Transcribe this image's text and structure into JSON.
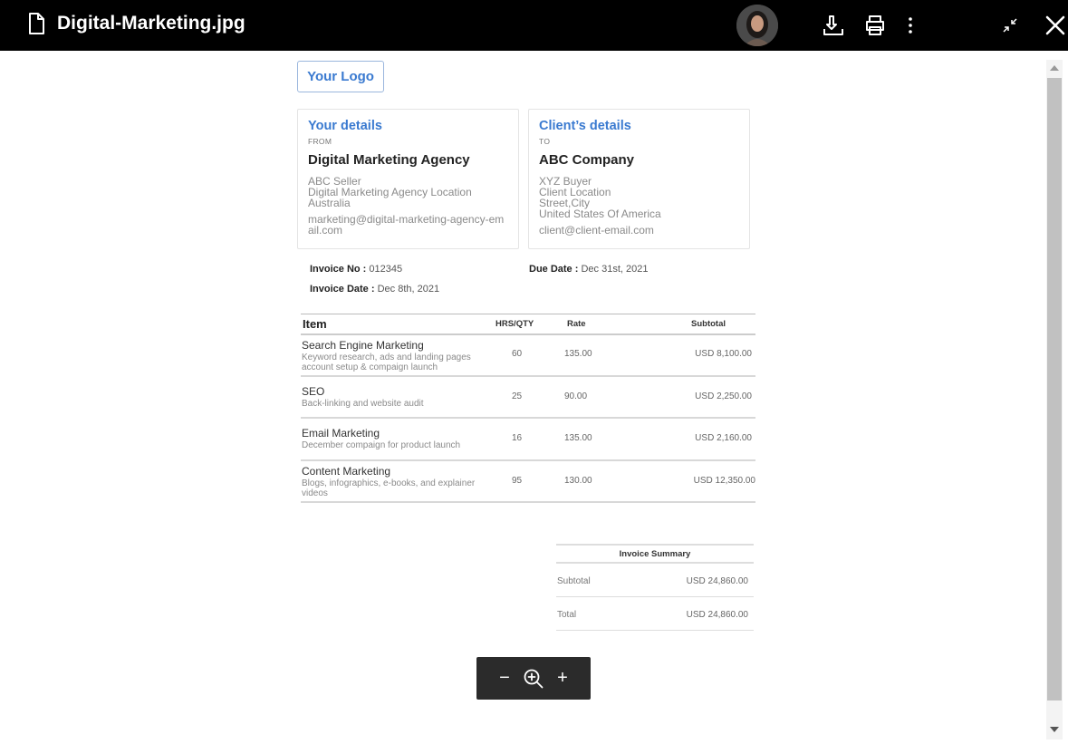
{
  "viewer": {
    "file_name": "Digital-Marketing.jpg",
    "icons": [
      "file-icon",
      "avatar",
      "download-icon",
      "print-icon",
      "more-icon",
      "collapse-icon",
      "close-icon"
    ]
  },
  "invoice": {
    "logo": "Your Logo",
    "from": {
      "title": "Your details",
      "label": "FROM",
      "name": "Digital Marketing Agency",
      "address_lines": [
        "ABC Seller",
        "Digital Marketing Agency Location",
        "Australia"
      ],
      "email": "marketing@digital-marketing-agency-email.com"
    },
    "to": {
      "title": "Client’s details",
      "label": "TO",
      "name": "ABC Company",
      "address_lines": [
        "XYZ Buyer",
        "Client Location",
        "Street,City",
        "United States Of America"
      ],
      "email": "client@client-email.com"
    },
    "meta": {
      "invoice_no_label": "Invoice No :",
      "invoice_no": "012345",
      "invoice_date_label": "Invoice Date :",
      "invoice_date": "Dec 8th, 2021",
      "due_date_label": "Due Date :",
      "due_date": "Dec 31st, 2021"
    },
    "columns": {
      "item": "Item",
      "qty": "HRS/QTY",
      "rate": "Rate",
      "subtotal": "Subtotal"
    },
    "items": [
      {
        "name": "Search Engine Marketing",
        "desc": "Keyword research, ads and landing pages account setup & compaign launch",
        "qty": "60",
        "rate": "135.00",
        "subtotal": "USD 8,100.00"
      },
      {
        "name": "SEO",
        "desc": "Back-linking and website audit",
        "qty": "25",
        "rate": "90.00",
        "subtotal": "USD 2,250.00"
      },
      {
        "name": "Email Marketing",
        "desc": "December compaign for product launch",
        "qty": "16",
        "rate": "135.00",
        "subtotal": "USD 2,160.00"
      },
      {
        "name": "Content Marketing",
        "desc": "Blogs, infographics, e-books, and explainer videos",
        "qty": "95",
        "rate": "130.00",
        "subtotal": "USD 12,350.00"
      }
    ],
    "summary": {
      "title": "Invoice Summary",
      "subtotal_label": "Subtotal",
      "subtotal": "USD 24,860.00",
      "total_label": "Total",
      "total": "USD 24,860.00"
    }
  },
  "zoom": {
    "minus": "−",
    "plus": "+",
    "icon": "zoom-in-icon"
  }
}
